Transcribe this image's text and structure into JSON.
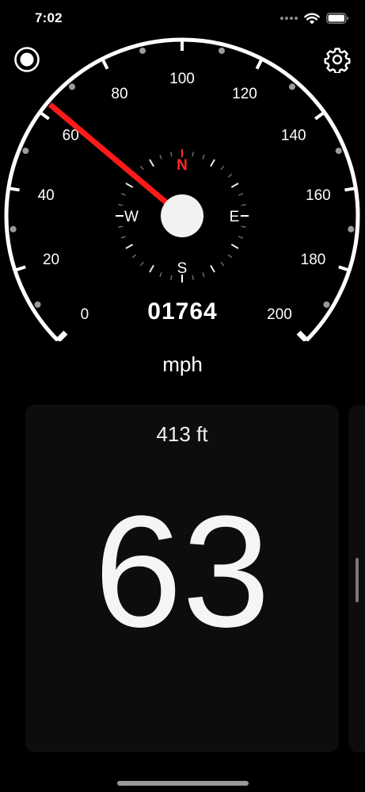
{
  "status_bar": {
    "time": "7:02",
    "signal_icon": "cellular-signal-icon",
    "wifi_icon": "wifi-icon",
    "battery_icon": "battery-icon"
  },
  "toolbar": {
    "record_icon": "record-icon",
    "settings_icon": "gear-icon"
  },
  "gauge": {
    "min": 0,
    "max": 200,
    "labels": [
      "0",
      "20",
      "40",
      "60",
      "80",
      "100",
      "120",
      "140",
      "160",
      "180",
      "200"
    ],
    "needle_value": 63,
    "needle_color": "#ff1a1a",
    "compass": {
      "north": "N",
      "east": "E",
      "south": "S",
      "west": "W",
      "north_color": "#ff2a2a"
    }
  },
  "odometer": "01764",
  "unit": "mph",
  "speed_card": {
    "altitude": "413 ft",
    "speed": "63"
  }
}
